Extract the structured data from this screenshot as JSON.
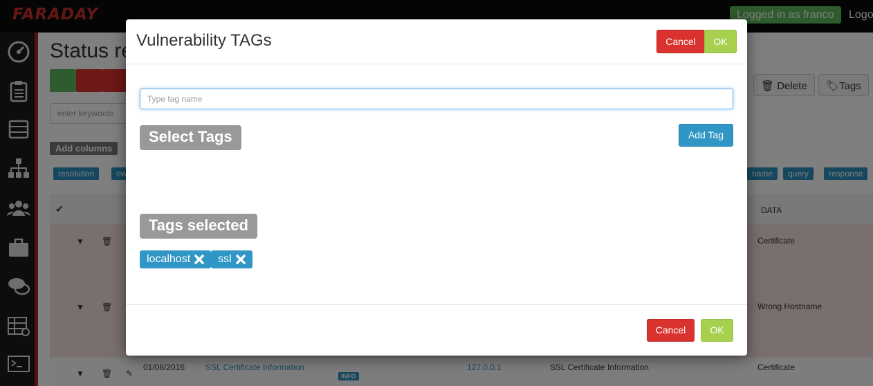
{
  "app": {
    "logo": "FARADAY",
    "logged_in": "Logged in as franco",
    "logout": "Logo"
  },
  "sidebar": {
    "items": [
      {
        "icon": "dashboard-icon"
      },
      {
        "icon": "clipboard-icon"
      },
      {
        "icon": "inbox-icon"
      },
      {
        "icon": "sitemap-icon"
      },
      {
        "icon": "users-icon"
      },
      {
        "icon": "briefcase-icon"
      },
      {
        "icon": "comments-icon"
      },
      {
        "icon": "table-icon"
      },
      {
        "icon": "terminal-icon"
      }
    ]
  },
  "page": {
    "title": "Status re",
    "search_placeholder": "enter keywords",
    "add_columns": "Add columns",
    "delete_label": "Delete",
    "tags_label": "Tags",
    "column_tags": [
      "resolution",
      "ow",
      "name",
      "query",
      "response"
    ],
    "data_header": "DATA",
    "rows": [
      {
        "data": "Certificate"
      },
      {
        "data": "Wrong Hostname"
      },
      {
        "date": "01/06/2016",
        "name": "SSL Certificate Information",
        "severity": "INFO",
        "target": "127.0.0.1",
        "desc": "SSL Certificate Information",
        "data": "Certificate"
      }
    ]
  },
  "modal": {
    "title": "Vulnerability TAGs",
    "cancel_label": "Cancel",
    "ok_label": "OK",
    "input_placeholder": "Type tag name",
    "input_value": "",
    "select_tags_label": "Select Tags",
    "add_tag_label": "Add Tag",
    "tags_selected_label": "Tags selected",
    "selected_tags": [
      "localhost",
      "ssl"
    ],
    "footer_cancel_label": "Cancel",
    "footer_ok_label": "OK"
  },
  "colors": {
    "cancel": "#d9322f",
    "ok": "#a6d04e",
    "primary": "#2f96c5",
    "label": "#999999",
    "logo": "#c9302c",
    "logged_in": "#5cb85c"
  }
}
